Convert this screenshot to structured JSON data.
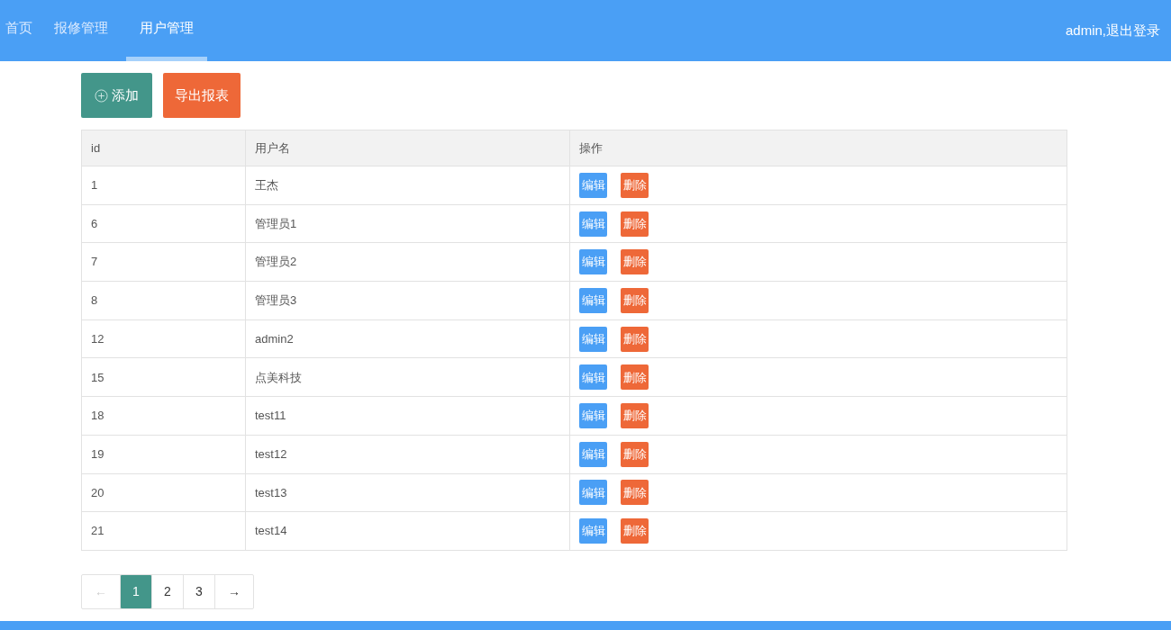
{
  "nav": {
    "items": [
      {
        "label": "首页",
        "selected": false
      },
      {
        "label": "报修管理",
        "selected": false
      },
      {
        "label": "用户管理",
        "selected": true
      }
    ],
    "user_link": "admin,退出登录"
  },
  "toolbar": {
    "add_button": "添加",
    "export_button": "导出报表"
  },
  "table": {
    "columns": [
      "id",
      "用户名",
      "操作"
    ],
    "rows": [
      {
        "id": "1",
        "username": "王杰",
        "edit": "编辑",
        "delete": "删除"
      },
      {
        "id": "6",
        "username": "管理员1",
        "edit": "编辑",
        "delete": "删除"
      },
      {
        "id": "7",
        "username": "管理员2",
        "edit": "编辑",
        "delete": "删除"
      },
      {
        "id": "8",
        "username": "管理员3",
        "edit": "编辑",
        "delete": "删除"
      },
      {
        "id": "12",
        "username": "admin2",
        "edit": "编辑",
        "delete": "删除"
      },
      {
        "id": "15",
        "username": "点美科技",
        "edit": "编辑",
        "delete": "删除"
      },
      {
        "id": "18",
        "username": "test11",
        "edit": "编辑",
        "delete": "删除"
      },
      {
        "id": "19",
        "username": "test12",
        "edit": "编辑",
        "delete": "删除"
      },
      {
        "id": "20",
        "username": "test13",
        "edit": "编辑",
        "delete": "删除"
      },
      {
        "id": "21",
        "username": "test14",
        "edit": "编辑",
        "delete": "删除"
      }
    ]
  },
  "pagination": {
    "prev": {
      "label": "←",
      "disabled": true
    },
    "pages": [
      {
        "label": "1",
        "selected": true
      },
      {
        "label": "2",
        "selected": false
      },
      {
        "label": "3",
        "selected": false
      }
    ],
    "next": {
      "label": "→",
      "disabled": false
    }
  }
}
